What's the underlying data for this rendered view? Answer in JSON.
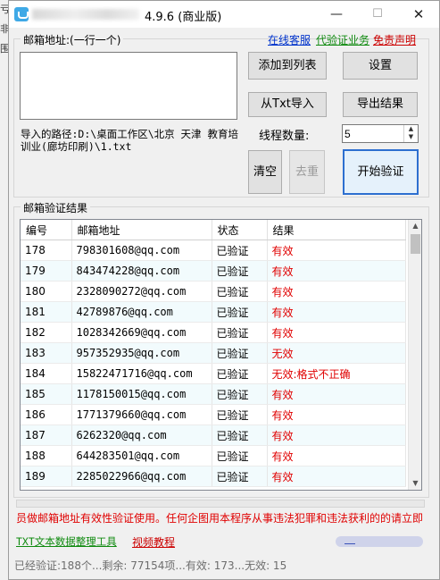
{
  "left_strip": {
    "chars": [
      "亏",
      "非",
      "围"
    ]
  },
  "window": {
    "version": "4.9.6",
    "edition": "(商业版)",
    "controls": {
      "minimize": "—",
      "maximize": "☐",
      "close": "✕"
    }
  },
  "input_group": {
    "label": "邮箱地址:(一行一个)"
  },
  "top_links": [
    {
      "text": "在线客服",
      "color": "#0033cc"
    },
    {
      "text": "代验证业务",
      "color": "#0f8a0f"
    },
    {
      "text": "免责声明",
      "color": "#cc0000"
    }
  ],
  "buttons": {
    "add_to_list": "添加到列表",
    "settings": "设置",
    "import_txt": "从Txt导入",
    "export_results": "导出结果",
    "clear": "清空",
    "dedupe": "去重",
    "start_verify": "开始验证"
  },
  "import_path": "导入的路径:D:\\桌面工作区\\北京 天津 教育培训业(廊坊印刷)\\1.txt",
  "threads": {
    "label": "线程数量:",
    "value": "5"
  },
  "results": {
    "label": "邮箱验证结果",
    "columns": [
      "编号",
      "邮箱地址",
      "状态",
      "结果"
    ],
    "rows": [
      {
        "id": "178",
        "email": "798301608@qq.com",
        "status": "已验证",
        "result": "有效"
      },
      {
        "id": "179",
        "email": "843474228@qq.com",
        "status": "已验证",
        "result": "有效"
      },
      {
        "id": "180",
        "email": "2328090272@qq.com",
        "status": "已验证",
        "result": "有效"
      },
      {
        "id": "181",
        "email": "42789876@qq.com",
        "status": "已验证",
        "result": "有效"
      },
      {
        "id": "182",
        "email": "1028342669@qq.com",
        "status": "已验证",
        "result": "有效"
      },
      {
        "id": "183",
        "email": "957352935@qq.com",
        "status": "已验证",
        "result": "无效"
      },
      {
        "id": "184",
        "email": "15822471716@qq.com",
        "status": "已验证",
        "result": "无效:格式不正确"
      },
      {
        "id": "185",
        "email": "1178150015@qq.com",
        "status": "已验证",
        "result": "有效"
      },
      {
        "id": "186",
        "email": "1771379660@qq.com",
        "status": "已验证",
        "result": "有效"
      },
      {
        "id": "187",
        "email": "6262320@qq.com",
        "status": "已验证",
        "result": "有效"
      },
      {
        "id": "188",
        "email": "644283501@qq.com",
        "status": "已验证",
        "result": "有效"
      },
      {
        "id": "189",
        "email": "2285022966@qq.com",
        "status": "已验证",
        "result": "有效"
      }
    ]
  },
  "notice": "员做邮箱地址有效性验证使用。任何企图用本程序从事违法犯罪和违法获利的的请立即",
  "bottom_links": [
    {
      "text": "TXT文本数据整理工具",
      "color": "#0f8a0f"
    },
    {
      "text": "视频教程",
      "color": "#cc0000"
    }
  ],
  "status_bar": "已经验证:188个...剩余: 77154项...有效: 173...无效: 15",
  "colors": {
    "accent": "#2d6fd0",
    "result_text": "#e00000",
    "alt_row": "#f2fbfd"
  }
}
